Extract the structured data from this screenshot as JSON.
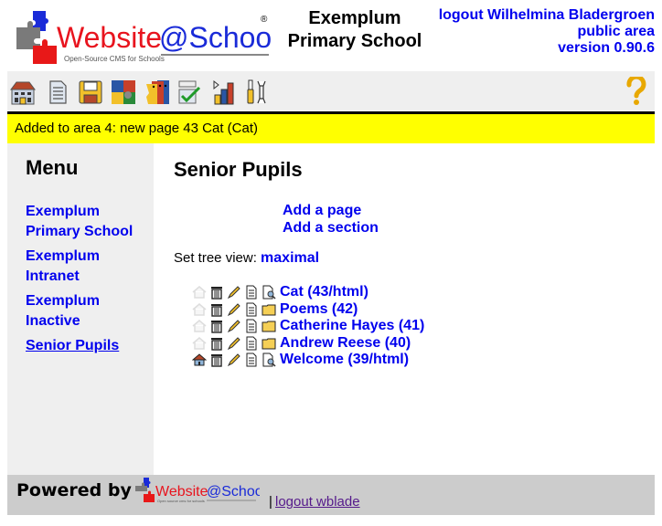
{
  "header": {
    "logo": {
      "name_part1": "Website",
      "name_part2": "@School",
      "registered": "®",
      "tagline": "Open-Source CMS for Schools"
    },
    "site_title_line1": "Exemplum",
    "site_title_line2": "Primary School",
    "logout_link": "logout Wilhelmina Bladergroen",
    "area_link": "public area",
    "version_link": "version 0.90.6"
  },
  "toolbar": {
    "icons": [
      {
        "name": "start-center",
        "icon": "building-icon"
      },
      {
        "name": "page-manager",
        "icon": "document-icon"
      },
      {
        "name": "file-manager",
        "icon": "floppy-disk-icon"
      },
      {
        "name": "modules",
        "icon": "puzzle-icon"
      },
      {
        "name": "account-manager",
        "icon": "faces-icon"
      },
      {
        "name": "configuration-manager",
        "icon": "checklist-icon"
      },
      {
        "name": "statistics",
        "icon": "bar-chart-icon"
      },
      {
        "name": "tools",
        "icon": "tools-icon"
      }
    ],
    "help_icon": "question-mark-icon"
  },
  "message": "Added to area 4: new page 43 Cat (Cat)",
  "sidebar": {
    "title": "Menu",
    "items": [
      {
        "line1": "Exemplum",
        "line2": "Primary School",
        "current": false
      },
      {
        "line1": "Exemplum",
        "line2": "Intranet",
        "current": false
      },
      {
        "line1": "Exemplum",
        "line2": "Inactive",
        "current": false
      },
      {
        "line1": "Senior Pupils",
        "line2": "",
        "current": true
      }
    ]
  },
  "main": {
    "title": "Senior Pupils",
    "add_page": "Add a page",
    "add_section": "Add a section",
    "tree_view_label": "Set tree view:",
    "tree_view_value": "maximal",
    "tree": [
      {
        "label": "Cat (43/html)",
        "type": "page",
        "is_default": false
      },
      {
        "label": "Poems (42)",
        "type": "section",
        "is_default": false
      },
      {
        "label": "Catherine Hayes (41)",
        "type": "section",
        "is_default": false
      },
      {
        "label": "Andrew Reese (40)",
        "type": "section",
        "is_default": false
      },
      {
        "label": "Welcome (39/html)",
        "type": "page",
        "is_default": true
      }
    ]
  },
  "footer": {
    "powered_by": "Powered by",
    "logo_part1": "Website",
    "logo_part2": "@School",
    "logo_tagline": "Open source cms for schools",
    "separator": "|",
    "logout": "logout wblade"
  },
  "colors": {
    "link": "#0000ee",
    "message_bg": "#ffff00",
    "sidebar_bg": "#efefef",
    "toolbar_bg": "#efefef",
    "footer_bg": "#cccccc",
    "visited_link": "#551a8b"
  }
}
